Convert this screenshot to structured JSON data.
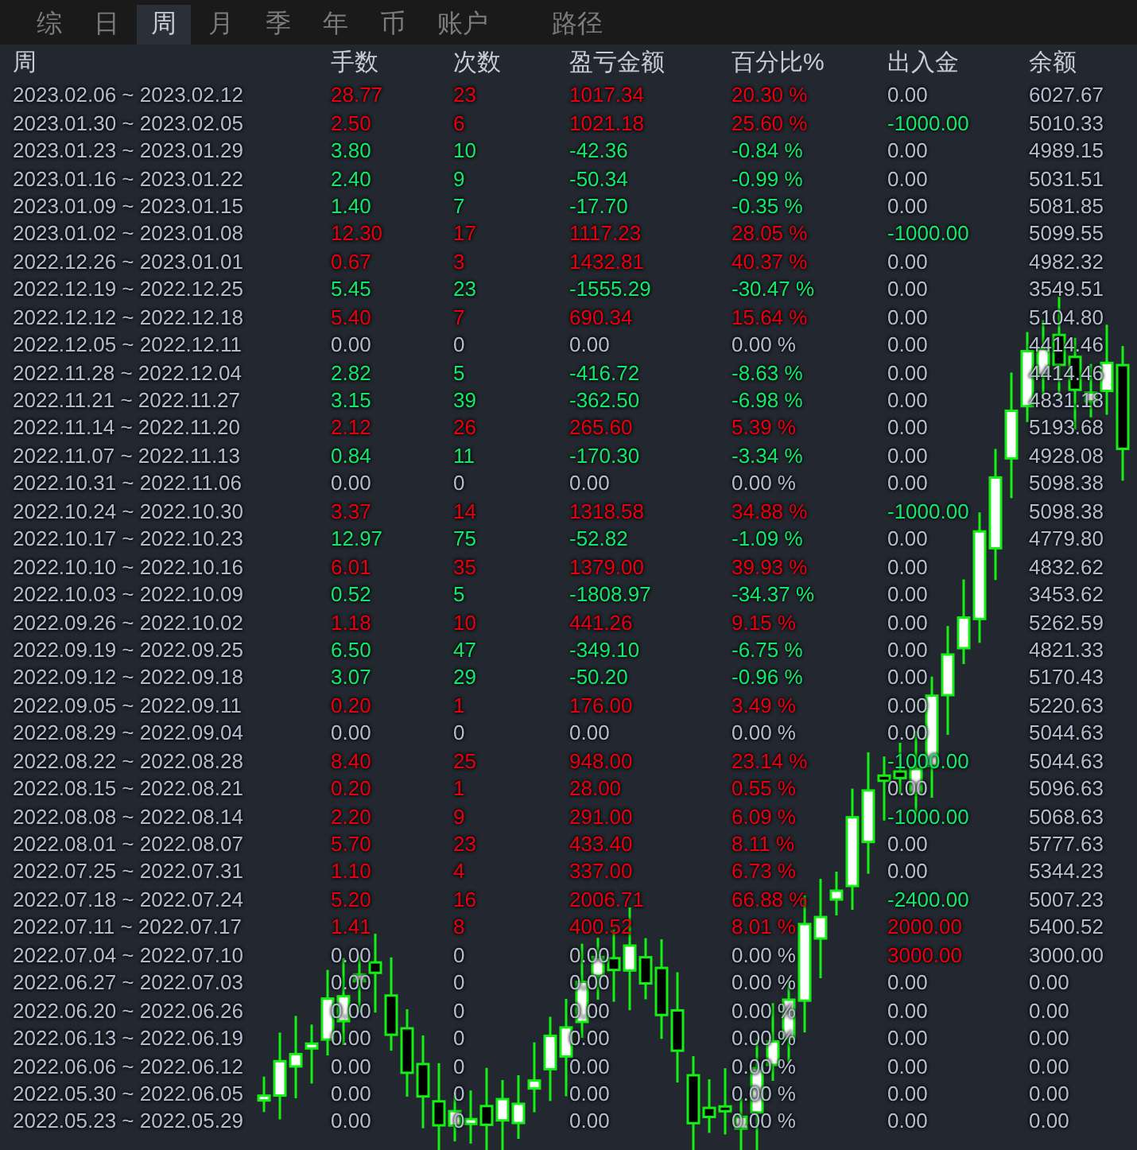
{
  "tabs": [
    {
      "label": "综",
      "selected": false
    },
    {
      "label": "日",
      "selected": false
    },
    {
      "label": "周",
      "selected": true
    },
    {
      "label": "月",
      "selected": false
    },
    {
      "label": "季",
      "selected": false
    },
    {
      "label": "年",
      "selected": false
    },
    {
      "label": "币",
      "selected": false
    },
    {
      "label": "账户",
      "selected": false
    },
    {
      "label": "路径",
      "selected": false
    }
  ],
  "table": {
    "columns": [
      "周",
      "手数",
      "次数",
      "盈亏金额",
      "百分比%",
      "出入金",
      "余额"
    ],
    "rows": [
      {
        "week": "2023.02.06 ~ 2023.02.12",
        "lots": "28.77",
        "trades": "23",
        "pnl": "1017.34",
        "pct": "20.30 %",
        "transfer": {
          "text": "0.00",
          "color": "#b4bdd0"
        },
        "balance": "6027.67",
        "color": "#e8000e"
      },
      {
        "week": "2023.01.30 ~ 2023.02.05",
        "lots": "2.50",
        "trades": "6",
        "pnl": "1021.18",
        "pct": "25.60 %",
        "transfer": {
          "text": "-1000.00",
          "color": "#14e86a"
        },
        "balance": "5010.33",
        "color": "#e8000e"
      },
      {
        "week": "2023.01.23 ~ 2023.01.29",
        "lots": "3.80",
        "trades": "10",
        "pnl": "-42.36",
        "pct": "-0.84 %",
        "transfer": {
          "text": "0.00",
          "color": "#b4bdd0"
        },
        "balance": "4989.15",
        "color": "#14e86a"
      },
      {
        "week": "2023.01.16 ~ 2023.01.22",
        "lots": "2.40",
        "trades": "9",
        "pnl": "-50.34",
        "pct": "-0.99 %",
        "transfer": {
          "text": "0.00",
          "color": "#b4bdd0"
        },
        "balance": "5031.51",
        "color": "#14e86a"
      },
      {
        "week": "2023.01.09 ~ 2023.01.15",
        "lots": "1.40",
        "trades": "7",
        "pnl": "-17.70",
        "pct": "-0.35 %",
        "transfer": {
          "text": "0.00",
          "color": "#b4bdd0"
        },
        "balance": "5081.85",
        "color": "#14e86a"
      },
      {
        "week": "2023.01.02 ~ 2023.01.08",
        "lots": "12.30",
        "trades": "17",
        "pnl": "1117.23",
        "pct": "28.05 %",
        "transfer": {
          "text": "-1000.00",
          "color": "#14e86a"
        },
        "balance": "5099.55",
        "color": "#e8000e"
      },
      {
        "week": "2022.12.26 ~ 2023.01.01",
        "lots": "0.67",
        "trades": "3",
        "pnl": "1432.81",
        "pct": "40.37 %",
        "transfer": {
          "text": "0.00",
          "color": "#b4bdd0"
        },
        "balance": "4982.32",
        "color": "#e8000e"
      },
      {
        "week": "2022.12.19 ~ 2022.12.25",
        "lots": "5.45",
        "trades": "23",
        "pnl": "-1555.29",
        "pct": "-30.47 %",
        "transfer": {
          "text": "0.00",
          "color": "#b4bdd0"
        },
        "balance": "3549.51",
        "color": "#14e86a"
      },
      {
        "week": "2022.12.12 ~ 2022.12.18",
        "lots": "5.40",
        "trades": "7",
        "pnl": "690.34",
        "pct": "15.64 %",
        "transfer": {
          "text": "0.00",
          "color": "#b4bdd0"
        },
        "balance": "5104.80",
        "color": "#e8000e"
      },
      {
        "week": "2022.12.05 ~ 2022.12.11",
        "lots": "0.00",
        "trades": "0",
        "pnl": "0.00",
        "pct": "0.00 %",
        "transfer": {
          "text": "0.00",
          "color": "#b4bdd0"
        },
        "balance": "4414.46",
        "color": "#b4bdd0"
      },
      {
        "week": "2022.11.28 ~ 2022.12.04",
        "lots": "2.82",
        "trades": "5",
        "pnl": "-416.72",
        "pct": "-8.63 %",
        "transfer": {
          "text": "0.00",
          "color": "#b4bdd0"
        },
        "balance": "4414.46",
        "color": "#14e86a"
      },
      {
        "week": "2022.11.21 ~ 2022.11.27",
        "lots": "3.15",
        "trades": "39",
        "pnl": "-362.50",
        "pct": "-6.98 %",
        "transfer": {
          "text": "0.00",
          "color": "#b4bdd0"
        },
        "balance": "4831.18",
        "color": "#14e86a"
      },
      {
        "week": "2022.11.14 ~ 2022.11.20",
        "lots": "2.12",
        "trades": "26",
        "pnl": "265.60",
        "pct": "5.39 %",
        "transfer": {
          "text": "0.00",
          "color": "#b4bdd0"
        },
        "balance": "5193.68",
        "color": "#e8000e"
      },
      {
        "week": "2022.11.07 ~ 2022.11.13",
        "lots": "0.84",
        "trades": "11",
        "pnl": "-170.30",
        "pct": "-3.34 %",
        "transfer": {
          "text": "0.00",
          "color": "#b4bdd0"
        },
        "balance": "4928.08",
        "color": "#14e86a"
      },
      {
        "week": "2022.10.31 ~ 2022.11.06",
        "lots": "0.00",
        "trades": "0",
        "pnl": "0.00",
        "pct": "0.00 %",
        "transfer": {
          "text": "0.00",
          "color": "#b4bdd0"
        },
        "balance": "5098.38",
        "color": "#b4bdd0"
      },
      {
        "week": "2022.10.24 ~ 2022.10.30",
        "lots": "3.37",
        "trades": "14",
        "pnl": "1318.58",
        "pct": "34.88 %",
        "transfer": {
          "text": "-1000.00",
          "color": "#14e86a"
        },
        "balance": "5098.38",
        "color": "#e8000e"
      },
      {
        "week": "2022.10.17 ~ 2022.10.23",
        "lots": "12.97",
        "trades": "75",
        "pnl": "-52.82",
        "pct": "-1.09 %",
        "transfer": {
          "text": "0.00",
          "color": "#b4bdd0"
        },
        "balance": "4779.80",
        "color": "#14e86a"
      },
      {
        "week": "2022.10.10 ~ 2022.10.16",
        "lots": "6.01",
        "trades": "35",
        "pnl": "1379.00",
        "pct": "39.93 %",
        "transfer": {
          "text": "0.00",
          "color": "#b4bdd0"
        },
        "balance": "4832.62",
        "color": "#e8000e"
      },
      {
        "week": "2022.10.03 ~ 2022.10.09",
        "lots": "0.52",
        "trades": "5",
        "pnl": "-1808.97",
        "pct": "-34.37 %",
        "transfer": {
          "text": "0.00",
          "color": "#b4bdd0"
        },
        "balance": "3453.62",
        "color": "#14e86a"
      },
      {
        "week": "2022.09.26 ~ 2022.10.02",
        "lots": "1.18",
        "trades": "10",
        "pnl": "441.26",
        "pct": "9.15 %",
        "transfer": {
          "text": "0.00",
          "color": "#b4bdd0"
        },
        "balance": "5262.59",
        "color": "#e8000e"
      },
      {
        "week": "2022.09.19 ~ 2022.09.25",
        "lots": "6.50",
        "trades": "47",
        "pnl": "-349.10",
        "pct": "-6.75 %",
        "transfer": {
          "text": "0.00",
          "color": "#b4bdd0"
        },
        "balance": "4821.33",
        "color": "#14e86a"
      },
      {
        "week": "2022.09.12 ~ 2022.09.18",
        "lots": "3.07",
        "trades": "29",
        "pnl": "-50.20",
        "pct": "-0.96 %",
        "transfer": {
          "text": "0.00",
          "color": "#b4bdd0"
        },
        "balance": "5170.43",
        "color": "#14e86a"
      },
      {
        "week": "2022.09.05 ~ 2022.09.11",
        "lots": "0.20",
        "trades": "1",
        "pnl": "176.00",
        "pct": "3.49 %",
        "transfer": {
          "text": "0.00",
          "color": "#b4bdd0"
        },
        "balance": "5220.63",
        "color": "#e8000e"
      },
      {
        "week": "2022.08.29 ~ 2022.09.04",
        "lots": "0.00",
        "trades": "0",
        "pnl": "0.00",
        "pct": "0.00 %",
        "transfer": {
          "text": "0.00",
          "color": "#b4bdd0"
        },
        "balance": "5044.63",
        "color": "#b4bdd0"
      },
      {
        "week": "2022.08.22 ~ 2022.08.28",
        "lots": "8.40",
        "trades": "25",
        "pnl": "948.00",
        "pct": "23.14 %",
        "transfer": {
          "text": "-1000.00",
          "color": "#14e86a"
        },
        "balance": "5044.63",
        "color": "#e8000e"
      },
      {
        "week": "2022.08.15 ~ 2022.08.21",
        "lots": "0.20",
        "trades": "1",
        "pnl": "28.00",
        "pct": "0.55 %",
        "transfer": {
          "text": "0.00",
          "color": "#b4bdd0"
        },
        "balance": "5096.63",
        "color": "#e8000e"
      },
      {
        "week": "2022.08.08 ~ 2022.08.14",
        "lots": "2.20",
        "trades": "9",
        "pnl": "291.00",
        "pct": "6.09 %",
        "transfer": {
          "text": "-1000.00",
          "color": "#14e86a"
        },
        "balance": "5068.63",
        "color": "#e8000e"
      },
      {
        "week": "2022.08.01 ~ 2022.08.07",
        "lots": "5.70",
        "trades": "23",
        "pnl": "433.40",
        "pct": "8.11 %",
        "transfer": {
          "text": "0.00",
          "color": "#b4bdd0"
        },
        "balance": "5777.63",
        "color": "#e8000e"
      },
      {
        "week": "2022.07.25 ~ 2022.07.31",
        "lots": "1.10",
        "trades": "4",
        "pnl": "337.00",
        "pct": "6.73 %",
        "transfer": {
          "text": "0.00",
          "color": "#b4bdd0"
        },
        "balance": "5344.23",
        "color": "#e8000e"
      },
      {
        "week": "2022.07.18 ~ 2022.07.24",
        "lots": "5.20",
        "trades": "16",
        "pnl": "2006.71",
        "pct": "66.88 %",
        "transfer": {
          "text": "-2400.00",
          "color": "#14e86a"
        },
        "balance": "5007.23",
        "color": "#e8000e"
      },
      {
        "week": "2022.07.11 ~ 2022.07.17",
        "lots": "1.41",
        "trades": "8",
        "pnl": "400.52",
        "pct": "8.01 %",
        "transfer": {
          "text": "2000.00",
          "color": "#e8000e"
        },
        "balance": "5400.52",
        "color": "#e8000e"
      },
      {
        "week": "2022.07.04 ~ 2022.07.10",
        "lots": "0.00",
        "trades": "0",
        "pnl": "0.00",
        "pct": "0.00 %",
        "transfer": {
          "text": "3000.00",
          "color": "#e8000e"
        },
        "balance": "3000.00",
        "color": "#b4bdd0"
      },
      {
        "week": "2022.06.27 ~ 2022.07.03",
        "lots": "0.00",
        "trades": "0",
        "pnl": "0.00",
        "pct": "0.00 %",
        "transfer": {
          "text": "0.00",
          "color": "#b4bdd0"
        },
        "balance": "0.00",
        "color": "#b4bdd0"
      },
      {
        "week": "2022.06.20 ~ 2022.06.26",
        "lots": "0.00",
        "trades": "0",
        "pnl": "0.00",
        "pct": "0.00 %",
        "transfer": {
          "text": "0.00",
          "color": "#b4bdd0"
        },
        "balance": "0.00",
        "color": "#b4bdd0"
      },
      {
        "week": "2022.06.13 ~ 2022.06.19",
        "lots": "0.00",
        "trades": "0",
        "pnl": "0.00",
        "pct": "0.00 %",
        "transfer": {
          "text": "0.00",
          "color": "#b4bdd0"
        },
        "balance": "0.00",
        "color": "#b4bdd0"
      },
      {
        "week": "2022.06.06 ~ 2022.06.12",
        "lots": "0.00",
        "trades": "0",
        "pnl": "0.00",
        "pct": "0.00 %",
        "transfer": {
          "text": "0.00",
          "color": "#b4bdd0"
        },
        "balance": "0.00",
        "color": "#b4bdd0"
      },
      {
        "week": "2022.05.30 ~ 2022.06.05",
        "lots": "0.00",
        "trades": "0",
        "pnl": "0.00",
        "pct": "0.00 %",
        "transfer": {
          "text": "0.00",
          "color": "#b4bdd0"
        },
        "balance": "0.00",
        "color": "#b4bdd0"
      },
      {
        "week": "2022.05.23 ~ 2022.05.29",
        "lots": "0.00",
        "trades": "0",
        "pnl": "0.00",
        "pct": "0.00 %",
        "transfer": {
          "text": "0.00",
          "color": "#b4bdd0"
        },
        "balance": "0.00",
        "color": "#b4bdd0"
      }
    ]
  }
}
